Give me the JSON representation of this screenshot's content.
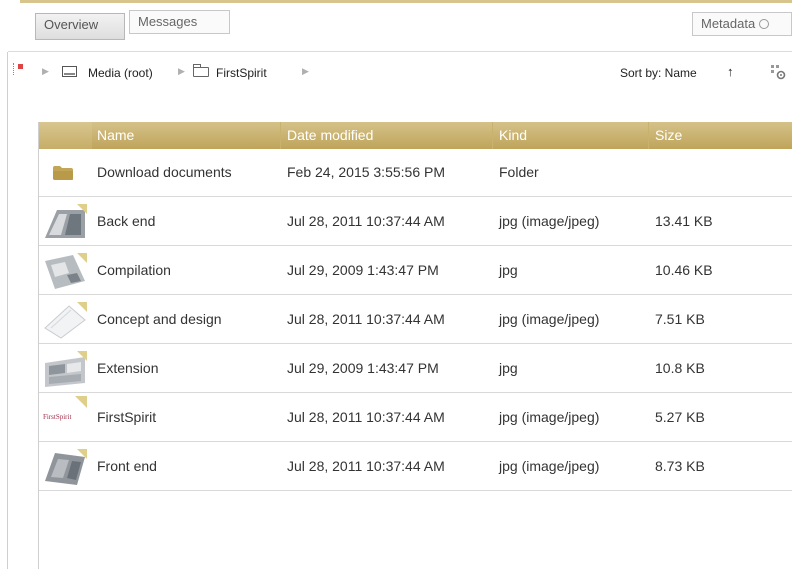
{
  "tabs": {
    "overview": "Overview",
    "messages": "Messages",
    "metadata": "Metadata"
  },
  "breadcrumb": {
    "root": "Media (root)",
    "folder": "FirstSpirit",
    "sort_label": "Sort by: Name",
    "sort_dir": "↑"
  },
  "columns": [
    "Name",
    "Date modified",
    "Kind",
    "Size"
  ],
  "rows": [
    {
      "name": "Download documents",
      "date": "Feb 24, 2015 3:55:56 PM",
      "kind": "Folder",
      "size": "",
      "icon": "folder-icon"
    },
    {
      "name": "Back end",
      "date": "Jul 28, 2011 10:37:44 AM",
      "kind": "jpg (image/jpeg)",
      "size": "13.41 KB",
      "icon": "image-thumbnail"
    },
    {
      "name": "Compilation",
      "date": "Jul 29, 2009 1:43:47 PM",
      "kind": "jpg",
      "size": "10.46 KB",
      "icon": "image-thumbnail"
    },
    {
      "name": "Concept and design",
      "date": "Jul 28, 2011 10:37:44 AM",
      "kind": "jpg (image/jpeg)",
      "size": "7.51 KB",
      "icon": "image-thumbnail"
    },
    {
      "name": "Extension",
      "date": "Jul 29, 2009 1:43:47 PM",
      "kind": "jpg",
      "size": "10.8 KB",
      "icon": "image-thumbnail"
    },
    {
      "name": "FirstSpirit",
      "date": "Jul 28, 2011 10:37:44 AM",
      "kind": "jpg (image/jpeg)",
      "size": "5.27 KB",
      "icon": "image-thumbnail",
      "thumb_text": "FirstSpirit"
    },
    {
      "name": "Front end",
      "date": "Jul 28, 2011 10:37:44 AM",
      "kind": "jpg (image/jpeg)",
      "size": "8.73 KB",
      "icon": "image-thumbnail"
    }
  ],
  "colors": {
    "header_gold": "#c9b06a",
    "accent_line": "#d8c58e",
    "folder": "#c2a656"
  }
}
